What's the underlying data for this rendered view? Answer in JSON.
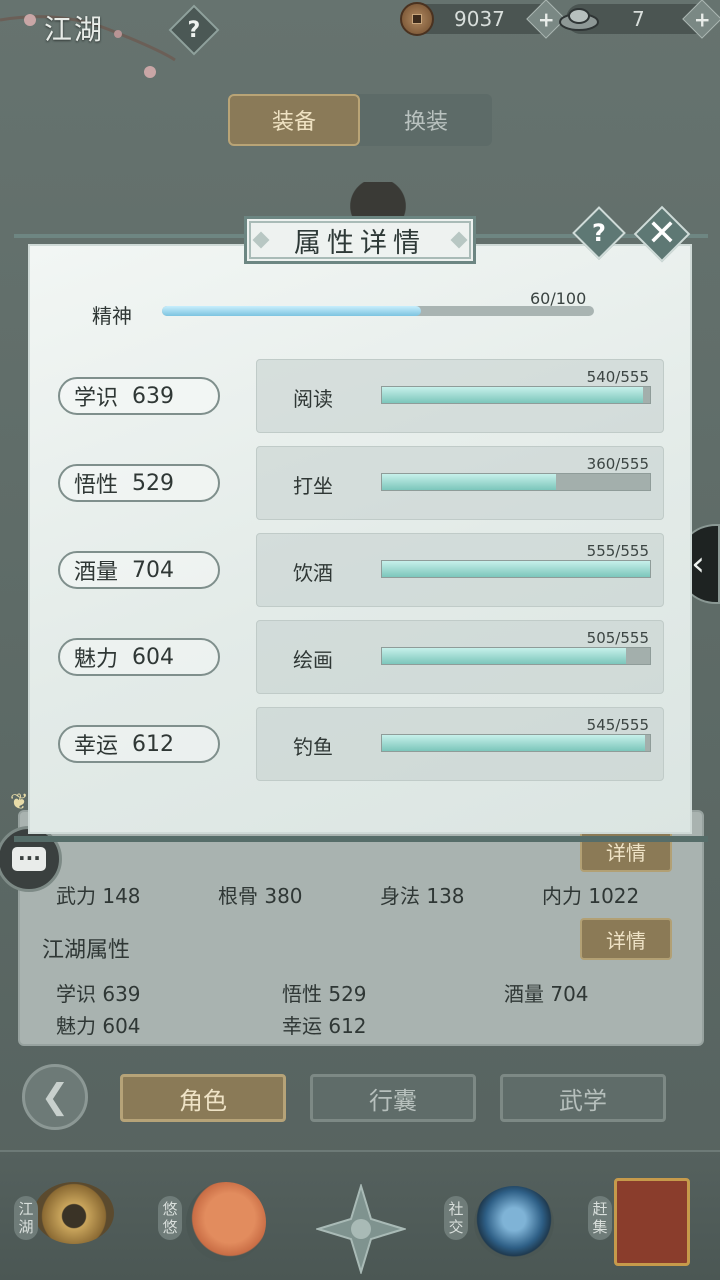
{
  "header": {
    "title": "江湖",
    "help_glyph": "?",
    "currencies": [
      {
        "icon": "copper-coin-icon",
        "value": "9037"
      },
      {
        "icon": "silver-ingot-icon",
        "value": "7"
      }
    ],
    "plus_glyph": "+"
  },
  "equip_toggle": {
    "tabs": [
      "装备",
      "换装"
    ],
    "active": "装备"
  },
  "modal": {
    "title": "属性详情",
    "help_glyph": "?",
    "close_glyph": "✕",
    "spirit": {
      "label": "精神",
      "value_text": "60/100",
      "fraction": 0.6
    },
    "rows": [
      {
        "stat_name": "学识",
        "stat_value": "639",
        "skill": "阅读",
        "skill_value": "540/555",
        "fraction": 0.973
      },
      {
        "stat_name": "悟性",
        "stat_value": "529",
        "skill": "打坐",
        "skill_value": "360/555",
        "fraction": 0.649
      },
      {
        "stat_name": "酒量",
        "stat_value": "704",
        "skill": "饮酒",
        "skill_value": "555/555",
        "fraction": 1.0
      },
      {
        "stat_name": "魅力",
        "stat_value": "604",
        "skill": "绘画",
        "skill_value": "505/555",
        "fraction": 0.91
      },
      {
        "stat_name": "幸运",
        "stat_value": "612",
        "skill": "钓鱼",
        "skill_value": "545/555",
        "fraction": 0.982
      }
    ]
  },
  "side_arrow": "‹",
  "base_panel": {
    "detail_label": "详情",
    "combat_stats": [
      {
        "text": "武力 148"
      },
      {
        "text": "根骨 380"
      },
      {
        "text": "身法 138"
      },
      {
        "text": "内力 1022"
      }
    ],
    "jianghu_title": "江湖属性",
    "jianghu_stats": [
      {
        "text": "学识 639"
      },
      {
        "text": "悟性 529"
      },
      {
        "text": "酒量 704"
      },
      {
        "text": "魅力 604"
      },
      {
        "text": "幸运 612"
      }
    ]
  },
  "nav": {
    "back_glyph": "❮",
    "tabs": [
      {
        "label": "角色",
        "active": true
      },
      {
        "label": "行囊",
        "active": false
      },
      {
        "label": "武学",
        "active": false
      }
    ]
  },
  "dock": {
    "items": [
      {
        "label": "江湖",
        "icon": "straw-hat-icon"
      },
      {
        "label": "悠悠",
        "icon": "swallow-icon"
      },
      {
        "label": "",
        "icon": "compass-flower-icon"
      },
      {
        "label": "社交",
        "icon": "wave-icon"
      },
      {
        "label": "赶集",
        "icon": "market-basket-icon"
      }
    ]
  },
  "colors": {
    "accent_gold": "#8a7a57",
    "bar_teal": "#7cc6bb",
    "spirit_blue": "#7cc4e0"
  }
}
